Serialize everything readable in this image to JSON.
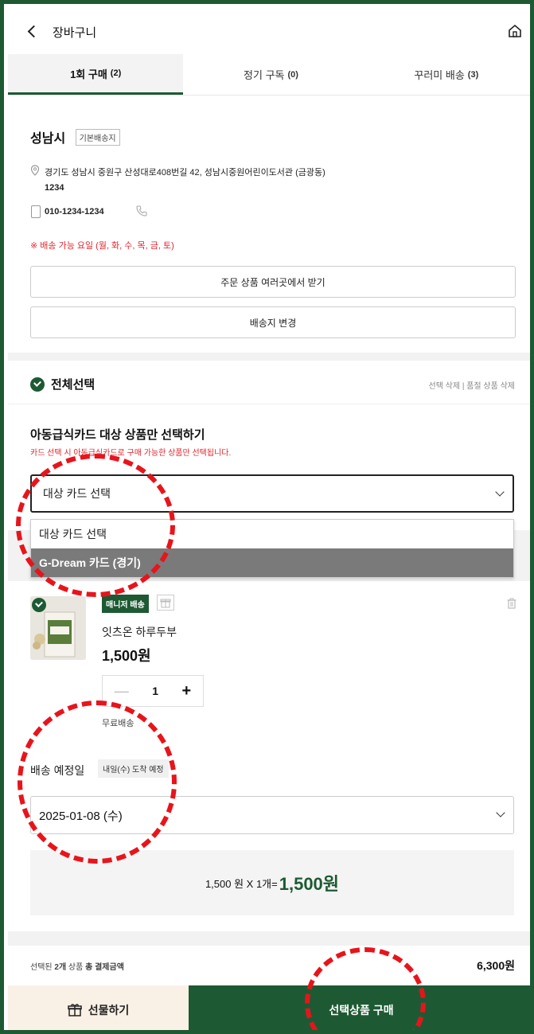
{
  "header": {
    "title": "장바구니"
  },
  "tabs": [
    {
      "label": "1회 구매",
      "count": "(2)"
    },
    {
      "label": "정기 구독",
      "count": "(0)"
    },
    {
      "label": "꾸러미 배송",
      "count": "(3)"
    }
  ],
  "address": {
    "name": "성남시",
    "tag": "기본배송지",
    "line1": "경기도 성남시 중원구 산성대로408번길 42, 성남시중원어린이도서관 (금광동)",
    "line2": "1234",
    "phone": "010-1234-1234",
    "delivery_days": "※ 배송 가능 요일 (월, 화, 수, 목, 금, 토)"
  },
  "buttons": {
    "multi_address": "주문 상품 여러곳에서 받기",
    "change_address": "배송지 변경"
  },
  "select_all": {
    "label": "전체선택",
    "actions": "선택 삭제  |  품절 상품 삭제"
  },
  "card_filter": {
    "title": "아동급식카드 대상 상품만 선택하기",
    "desc": "카드 선택 시 아동급식카드로 구매 가능한 상품만 선택됩니다.",
    "selected": "대상 카드 선택",
    "options": [
      "대상 카드 선택",
      "G-Dream 카드 (경기)"
    ]
  },
  "product": {
    "badge": "매니저 배송",
    "name": "잇츠온 하루두부",
    "price": "1,500원",
    "qty": "1",
    "shipping": "무료배송"
  },
  "delivery": {
    "label": "배송 예정일",
    "tag": "내일(수) 도착 예정",
    "date": "2025-01-08 (수)"
  },
  "summary": {
    "calc": "1,500 원 X 1개= ",
    "total": "1,500원"
  },
  "footer": {
    "label_pre": "선택된 ",
    "label_count": "2개",
    "label_mid": " 상품 ",
    "label_bold": "총 결제금액",
    "amount": "6,300원",
    "gift_label": "선물하기",
    "buy_label": "선택상품 구매"
  },
  "colors": {
    "brand": "#1d5a33",
    "alert": "#e0262d",
    "annotation": "#e8141b"
  }
}
